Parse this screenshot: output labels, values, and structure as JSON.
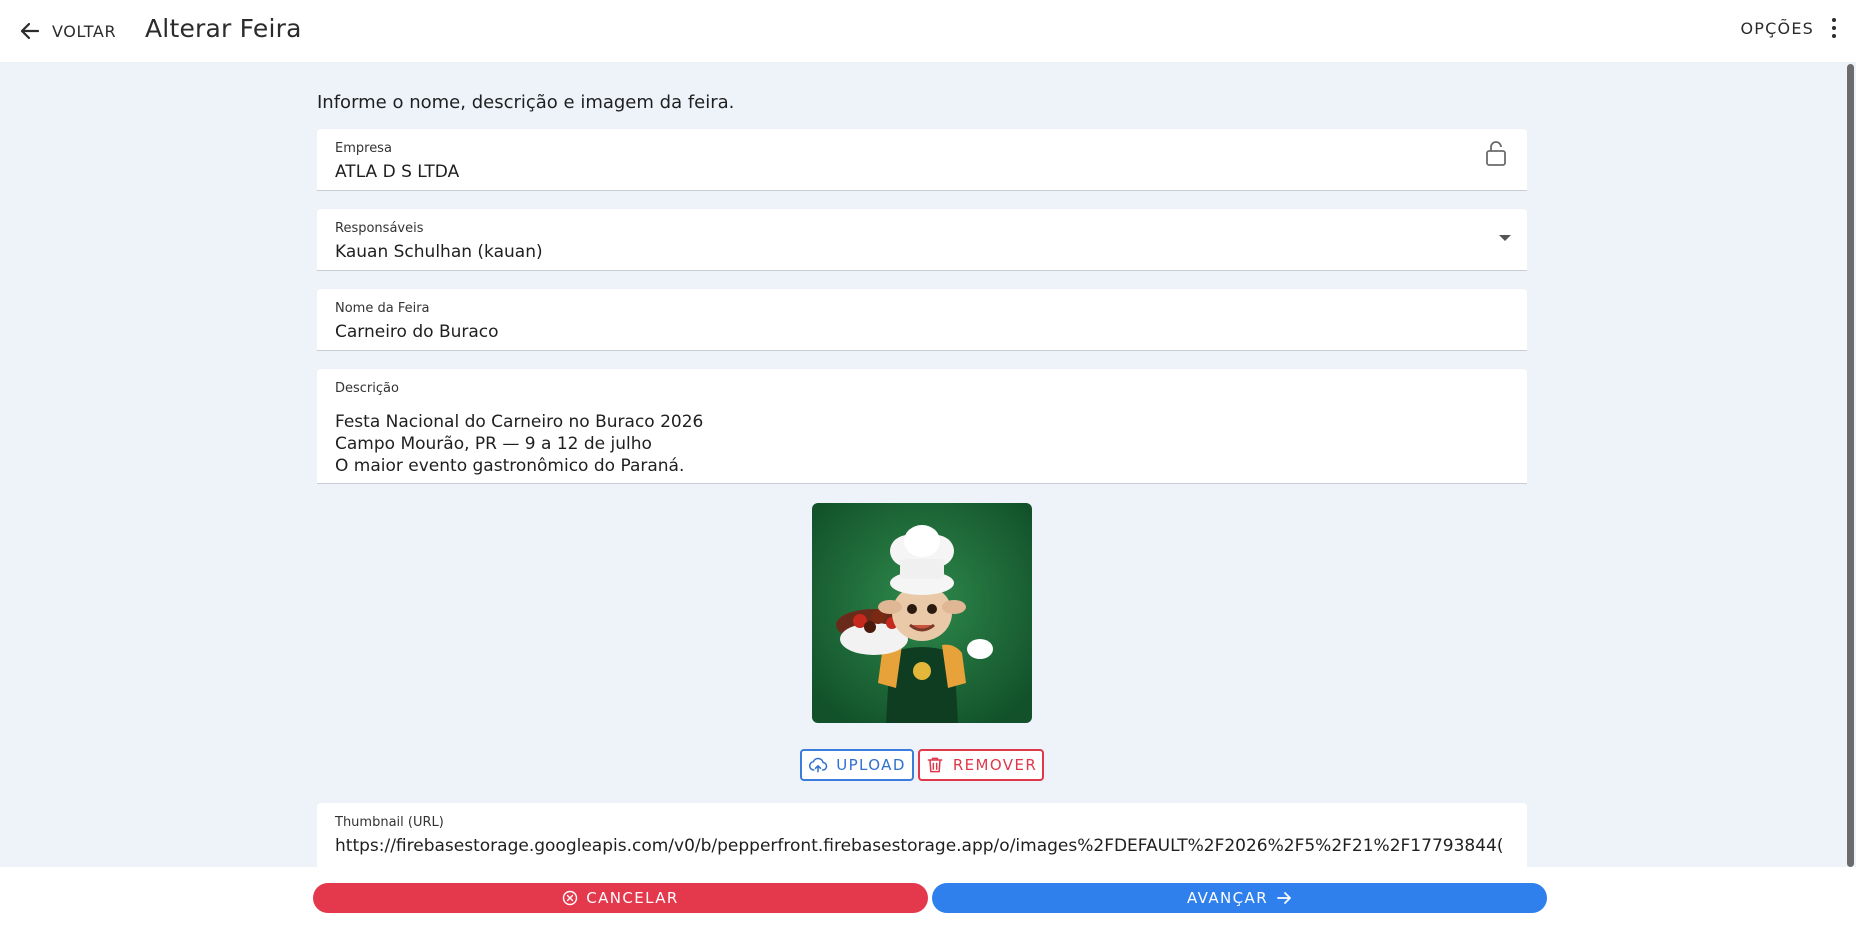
{
  "header": {
    "back_label": "VOLTAR",
    "title": "Alterar Feira",
    "options_label": "OPÇÕES"
  },
  "form": {
    "intro": "Informe o nome, descrição e imagem da feira.",
    "empresa": {
      "label": "Empresa",
      "value": "ATLA D S LTDA"
    },
    "responsaveis": {
      "label": "Responsáveis",
      "value": "Kauan Schulhan (kauan)"
    },
    "nome": {
      "label": "Nome da Feira",
      "value": "Carneiro do Buraco"
    },
    "descricao": {
      "label": "Descrição",
      "lines": [
        "Festa Nacional do Carneiro no Buraco 2026",
        "Campo Mourão, PR — 9 a 12 de julho",
        "O maior evento gastronômico do Paraná."
      ]
    },
    "image_buttons": {
      "upload": "UPLOAD",
      "remove": "REMOVER"
    },
    "thumbnail": {
      "label": "Thumbnail (URL)",
      "value": "https://firebasestorage.googleapis.com/v0/b/pepperfront.firebasestorage.app/o/images%2FDEFAULT%2F2026%2F5%2F21%2F17793844("
    }
  },
  "footer": {
    "cancel_label": "CANCELAR",
    "next_label": "AVANÇAR"
  },
  "colors": {
    "background": "#eef3fa",
    "primary": "#2f80ed",
    "danger": "#e4384c",
    "mascot_bg": "#1f6b3a"
  }
}
